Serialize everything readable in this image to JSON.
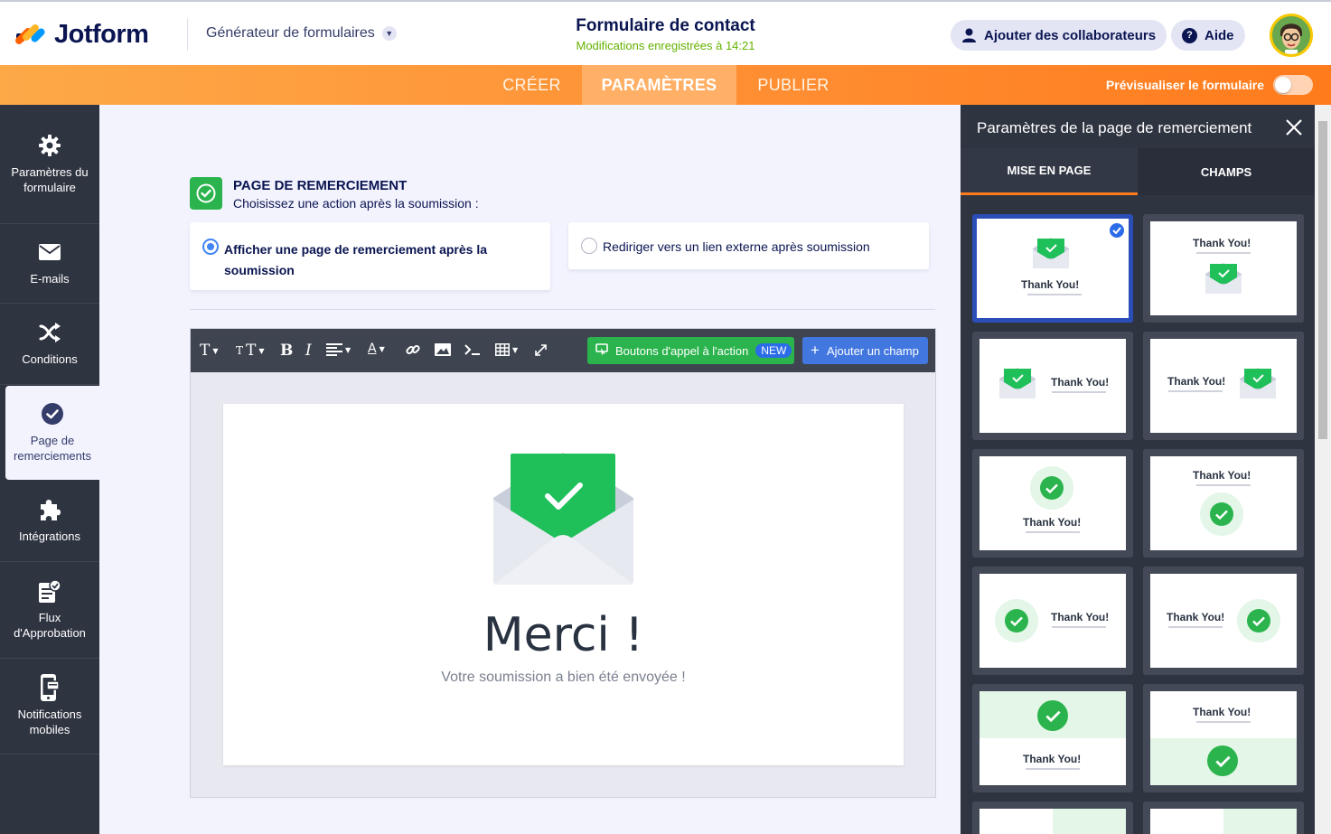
{
  "header": {
    "logo_text": "Jotform",
    "builder_menu": "Générateur de formulaires",
    "form_title": "Formulaire de contact",
    "save_status": "Modifications enregistrées à 14:21",
    "collaborators_label": "Ajouter des collaborateurs",
    "help_label": "Aide"
  },
  "nav": {
    "tabs": [
      "CRÉER",
      "PARAMÈTRES",
      "PUBLIER"
    ],
    "active_tab": "PARAMÈTRES",
    "preview_label": "Prévisualiser le formulaire",
    "preview_on": false
  },
  "sidebar": {
    "items": [
      {
        "label": "Paramètres du formulaire",
        "icon": "gear-icon"
      },
      {
        "label": "E-mails",
        "icon": "envelope-icon"
      },
      {
        "label": "Conditions",
        "icon": "shuffle-icon"
      },
      {
        "label": "Page de remerciements",
        "icon": "check-circle-icon"
      },
      {
        "label": "Intégrations",
        "icon": "puzzle-icon"
      },
      {
        "label": "Flux d'Approbation",
        "icon": "approval-icon"
      },
      {
        "label": "Notifications mobiles",
        "icon": "mobile-icon"
      }
    ],
    "active_index": 3
  },
  "main": {
    "section_title": "PAGE DE REMERCIEMENT",
    "section_subtitle": "Choisissez une action après la soumission :",
    "option_show": "Afficher une page de remerciement après la soumission",
    "option_redirect": "Rediriger vers un lien externe après soumission",
    "selected_option": "show",
    "toolbar": {
      "cta_label": "Boutons d'appel à l'action",
      "new_badge": "NEW",
      "add_field_label": "Ajouter un champ"
    },
    "preview": {
      "heading": "Merci !",
      "message": "Votre soumission a bien été envoyée !"
    }
  },
  "right_panel": {
    "title": "Paramètres de la page de remerciement",
    "tabs": [
      "MISE EN PAGE",
      "CHAMPS"
    ],
    "active_tab": "MISE EN PAGE",
    "tile_text": "Thank You!",
    "selected_tile": 0
  },
  "colors": {
    "brand_orange": "#ff7b1c",
    "green": "#2bb44d",
    "blue": "#4277e0",
    "sidebar_dark": "#2f3441",
    "navy": "#0a1551"
  }
}
